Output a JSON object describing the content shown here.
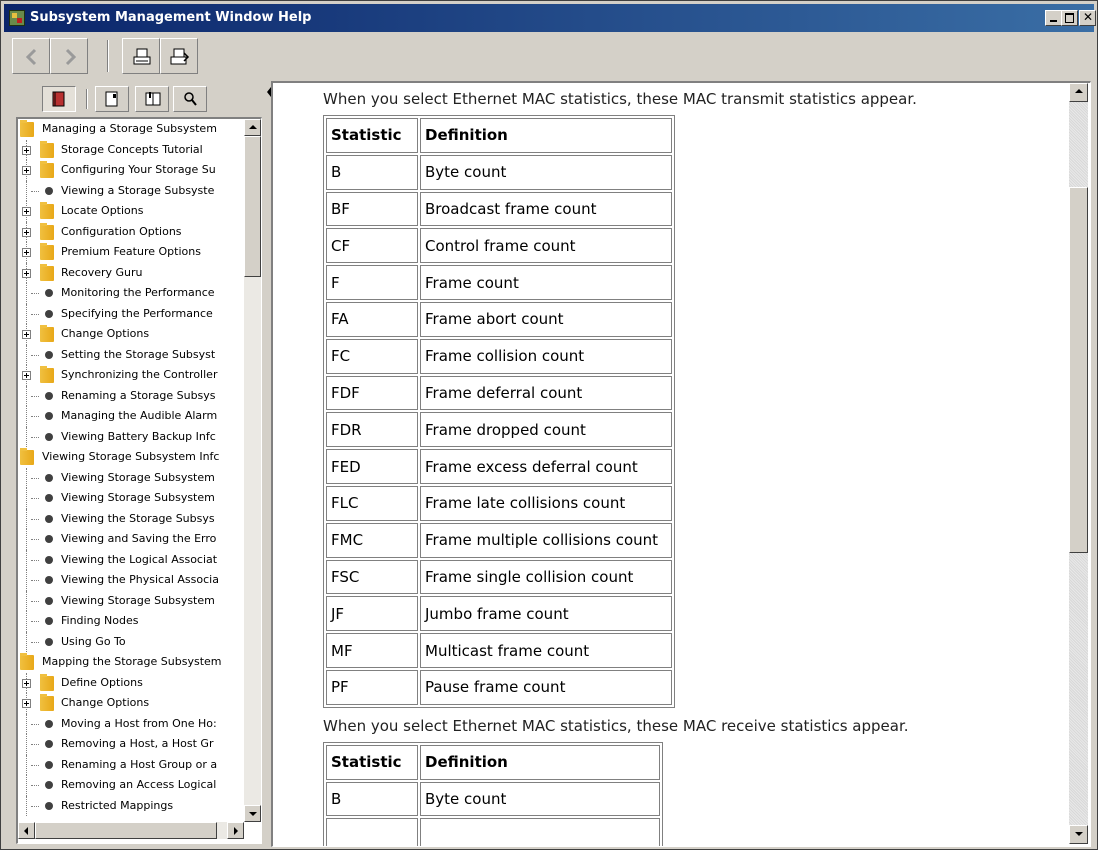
{
  "window": {
    "title": "Subsystem Management Window Help"
  },
  "toolbar": {
    "back": "back-arrow-icon",
    "forward": "forward-arrow-icon",
    "print": "print-icon",
    "print_setup": "print-setup-icon"
  },
  "nav_tabs": [
    "contents-book-icon",
    "index-page-icon",
    "bookmarks-icon",
    "search-magnifier-icon"
  ],
  "tree": [
    {
      "label": "Managing a Storage Subsystem",
      "level": 0,
      "type": "folder",
      "expander": false
    },
    {
      "label": "Storage Concepts Tutorial",
      "level": 1,
      "type": "folder",
      "expander": true
    },
    {
      "label": "Configuring Your Storage Su",
      "level": 1,
      "type": "folder",
      "expander": true
    },
    {
      "label": "Viewing a Storage Subsyste",
      "level": 1,
      "type": "doc",
      "expander": false
    },
    {
      "label": "Locate Options",
      "level": 1,
      "type": "folder",
      "expander": true
    },
    {
      "label": "Configuration Options",
      "level": 1,
      "type": "folder",
      "expander": true
    },
    {
      "label": "Premium Feature Options",
      "level": 1,
      "type": "folder",
      "expander": true
    },
    {
      "label": "Recovery Guru",
      "level": 1,
      "type": "folder",
      "expander": true
    },
    {
      "label": "Monitoring the Performance",
      "level": 1,
      "type": "doc",
      "expander": false
    },
    {
      "label": "Specifying the Performance",
      "level": 1,
      "type": "doc",
      "expander": false
    },
    {
      "label": "Change Options",
      "level": 1,
      "type": "folder",
      "expander": true
    },
    {
      "label": "Setting the Storage Subsyst",
      "level": 1,
      "type": "doc",
      "expander": false
    },
    {
      "label": "Synchronizing the Controller",
      "level": 1,
      "type": "folder",
      "expander": true
    },
    {
      "label": "Renaming a Storage Subsys",
      "level": 1,
      "type": "doc",
      "expander": false
    },
    {
      "label": "Managing the Audible Alarm",
      "level": 1,
      "type": "doc",
      "expander": false
    },
    {
      "label": "Viewing Battery Backup Infc",
      "level": 1,
      "type": "doc",
      "expander": false
    },
    {
      "label": "Viewing Storage Subsystem Infc",
      "level": 0,
      "type": "folder",
      "expander": false
    },
    {
      "label": "Viewing Storage Subsystem",
      "level": 1,
      "type": "doc",
      "expander": false
    },
    {
      "label": "Viewing Storage Subsystem",
      "level": 1,
      "type": "doc",
      "expander": false
    },
    {
      "label": "Viewing the Storage Subsys",
      "level": 1,
      "type": "doc",
      "expander": false
    },
    {
      "label": "Viewing and Saving the Erro",
      "level": 1,
      "type": "doc",
      "expander": false
    },
    {
      "label": "Viewing the Logical Associat",
      "level": 1,
      "type": "doc",
      "expander": false
    },
    {
      "label": "Viewing the Physical Associa",
      "level": 1,
      "type": "doc",
      "expander": false
    },
    {
      "label": "Viewing Storage Subsystem",
      "level": 1,
      "type": "doc",
      "expander": false
    },
    {
      "label": "Finding Nodes",
      "level": 1,
      "type": "doc",
      "expander": false
    },
    {
      "label": "Using Go To",
      "level": 1,
      "type": "doc",
      "expander": false
    },
    {
      "label": "Mapping the Storage Subsystem",
      "level": 0,
      "type": "folder",
      "expander": false
    },
    {
      "label": "Define Options",
      "level": 1,
      "type": "folder",
      "expander": true
    },
    {
      "label": "Change Options",
      "level": 1,
      "type": "folder",
      "expander": true
    },
    {
      "label": "Moving a Host from One Ho:",
      "level": 1,
      "type": "doc",
      "expander": false
    },
    {
      "label": "Removing a Host, a Host Gr",
      "level": 1,
      "type": "doc",
      "expander": false
    },
    {
      "label": "Renaming a Host Group or a",
      "level": 1,
      "type": "doc",
      "expander": false
    },
    {
      "label": "Removing an Access Logical",
      "level": 1,
      "type": "doc",
      "expander": false
    },
    {
      "label": "Restricted Mappings",
      "level": 1,
      "type": "doc",
      "expander": false
    }
  ],
  "content": {
    "transmit_intro": "When you select Ethernet MAC statistics, these MAC transmit statistics appear.",
    "receive_intro": "When you select Ethernet MAC statistics, these MAC receive statistics appear.",
    "headers": [
      "Statistic",
      "Definition"
    ],
    "transmit_rows": [
      [
        "B",
        "Byte count"
      ],
      [
        "BF",
        "Broadcast frame count"
      ],
      [
        "CF",
        "Control frame count"
      ],
      [
        "F",
        "Frame count"
      ],
      [
        "FA",
        "Frame abort count"
      ],
      [
        "FC",
        "Frame collision count"
      ],
      [
        "FDF",
        "Frame deferral count"
      ],
      [
        "FDR",
        "Frame dropped count"
      ],
      [
        "FED",
        "Frame excess deferral count"
      ],
      [
        "FLC",
        "Frame late collisions count"
      ],
      [
        "FMC",
        "Frame multiple collisions count"
      ],
      [
        "FSC",
        "Frame single collision count"
      ],
      [
        "JF",
        "Jumbo frame count"
      ],
      [
        "MF",
        "Multicast frame count"
      ],
      [
        "PF",
        "Pause frame count"
      ]
    ],
    "receive_rows": [
      [
        "B",
        "Byte count"
      ],
      [
        "",
        ""
      ]
    ]
  }
}
